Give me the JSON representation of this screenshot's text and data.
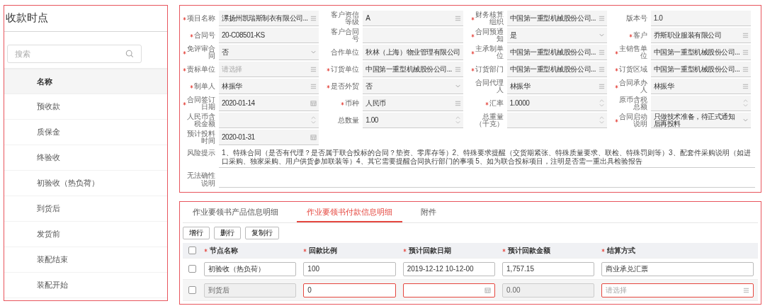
{
  "left_panel": {
    "title": "收款时点",
    "search": {
      "placeholder": "搜索"
    },
    "column": "名称",
    "items": [
      "预收款",
      "质保金",
      "终验收",
      "初验收（热负荷）",
      "到货后",
      "发货前",
      "装配结束",
      "装配开始"
    ]
  },
  "form": {
    "fields": [
      {
        "label": "项目名称",
        "required": true,
        "kind": "select",
        "value": "漯扬州凯瑞斯制衣有限公司..."
      },
      {
        "label": "客户资信等级",
        "required": false,
        "kind": "select",
        "value": "A"
      },
      {
        "label": "财务核算组织",
        "required": true,
        "kind": "select",
        "value": "中国第一重型机械股份公司..."
      },
      {
        "label": "版本号",
        "required": false,
        "kind": "text",
        "value": "1.0"
      },
      {
        "label": "合同号",
        "required": true,
        "kind": "text",
        "value": "20-C08501-KS"
      },
      {
        "label": "客户合同号",
        "required": false,
        "kind": "text"
      },
      {
        "label": "合同预通知",
        "required": true,
        "kind": "dropdown",
        "value": "是"
      },
      {
        "label": "客户",
        "required": true,
        "kind": "select",
        "value": "乔斯职业服装有限公司"
      },
      {
        "label": "免评审合同",
        "required": true,
        "kind": "dropdown",
        "value": "否"
      },
      {
        "label": "合作单位",
        "required": false,
        "kind": "text",
        "value": "秋林（上海）物业管理有限公司"
      },
      {
        "label": "主承制单位",
        "required": true,
        "kind": "select",
        "value": "中国第一重型机械股份公司..."
      },
      {
        "label": "主销售单位",
        "required": true,
        "kind": "select",
        "value": "中国第一重型机械股份公司..."
      },
      {
        "label": "责标单位",
        "required": true,
        "kind": "select",
        "placeholder": "请选择"
      },
      {
        "label": "订货单位",
        "required": true,
        "kind": "select",
        "value": "中国第一重型机械股份公司..."
      },
      {
        "label": "订货部门",
        "required": true,
        "kind": "select",
        "value": "中国第一重型机械股份公司..."
      },
      {
        "label": "订货区域",
        "required": true,
        "kind": "select",
        "value": "中国第一重型机械股份公司..."
      },
      {
        "label": "制单人",
        "required": true,
        "kind": "select",
        "value": "林振华"
      },
      {
        "label": "是否外贸",
        "required": true,
        "kind": "dropdown",
        "value": "否"
      },
      {
        "label": "合同代理人",
        "required": false,
        "kind": "select",
        "value": "林振华"
      },
      {
        "label": "合同承办人",
        "required": true,
        "kind": "select",
        "value": "林振华"
      },
      {
        "label": "合同签订日期",
        "required": true,
        "kind": "date",
        "value": "2020-01-14"
      },
      {
        "label": "币种",
        "required": true,
        "kind": "select",
        "value": "人民币"
      },
      {
        "label": "汇率",
        "required": true,
        "kind": "number",
        "value": "1.0000"
      },
      {
        "label": "原币含税总额",
        "required": false,
        "kind": "number"
      },
      {
        "label": "人民币含税金额",
        "required": false,
        "kind": "number"
      },
      {
        "label": "总数量",
        "required": false,
        "kind": "number",
        "value": "1.00"
      },
      {
        "label": "总重量（千克）",
        "required": false,
        "kind": "number"
      },
      {
        "label": "合同启动说明",
        "required": true,
        "kind": "dropdown",
        "value": "只做技术准备，待正式通知后再投料"
      },
      {
        "label": "预计投料时间",
        "required": false,
        "kind": "date",
        "value": "2020-01-31"
      }
    ],
    "notes": [
      {
        "label": "风险提示",
        "value": "1、特殊合同（是否有代理？是否属于联合投标的合同？垫资、零库存等）2、特殊要求提醒（交货期紧张、特殊质量要求、联检、特殊罚则等）3、配套件采购说明（如进口采购、独家采购、用户供货参加联装等）4、其它需要提醒合同执行部门的事项 5、如为联合投标项目，注明是否需一重出具检验报告"
      },
      {
        "label": "无法确性说明"
      }
    ]
  },
  "detail": {
    "tabs": [
      {
        "label": "作业要领书产品信息明细",
        "selected": false
      },
      {
        "label": "作业要领书付款信息明细",
        "selected": true
      },
      {
        "label": "附件",
        "selected": false
      }
    ],
    "buttons": [
      "增行",
      "删行",
      "复制行"
    ],
    "all_checked": false,
    "columns": [
      {
        "label": "节点名称",
        "required": true
      },
      {
        "label": "回款比例",
        "required": true
      },
      {
        "label": "预计回款日期",
        "required": true
      },
      {
        "label": "预计回款金额",
        "required": true
      },
      {
        "label": "结算方式",
        "required": true
      }
    ],
    "rows": [
      {
        "checked": false,
        "cells": [
          {
            "kind": "text",
            "value": "初验收（热负荷）",
            "disabled": false,
            "error": false
          },
          {
            "kind": "text",
            "value": "100",
            "disabled": false,
            "error": false
          },
          {
            "kind": "text",
            "value": "2019-12-12 10-12-00",
            "disabled": false,
            "error": false
          },
          {
            "kind": "text",
            "value": "1,757.15",
            "disabled": false,
            "error": false
          },
          {
            "kind": "text",
            "value": "商业承兑汇票",
            "disabled": false,
            "error": false
          }
        ]
      },
      {
        "checked": false,
        "cells": [
          {
            "kind": "text",
            "value": "到货后",
            "disabled": true,
            "error": false
          },
          {
            "kind": "text",
            "value": "0",
            "disabled": false,
            "error": true
          },
          {
            "kind": "date",
            "disabled": false,
            "error": true
          },
          {
            "kind": "text",
            "value": "0.00",
            "disabled": true,
            "error": false
          },
          {
            "kind": "select",
            "placeholder": "请选择",
            "disabled": false,
            "error": true
          }
        ]
      }
    ]
  }
}
